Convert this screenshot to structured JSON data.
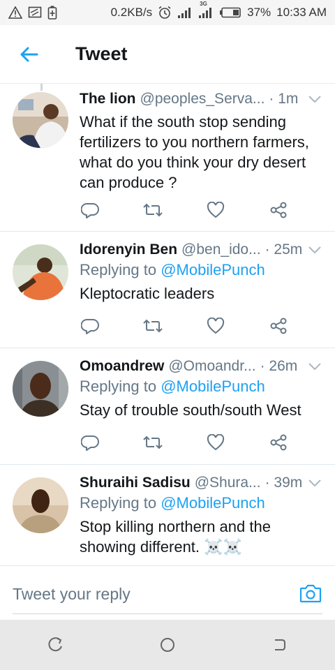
{
  "statusbar": {
    "network_speed": "0.2KB/s",
    "network_type": "3G",
    "battery": "37%",
    "time": "10:33 AM",
    "icons": [
      "warning-icon",
      "cast-icon",
      "battery-saver-icon",
      "alarm-icon",
      "signal-icon",
      "signal-3g-icon",
      "battery-icon"
    ]
  },
  "header": {
    "title": "Tweet",
    "back_icon": "arrow-left-icon"
  },
  "tweets": [
    {
      "name": "The lion",
      "handle": "@peoples_Serva...",
      "time": "· 1m",
      "reply_prefix": "",
      "mention": "",
      "text": "What if the south stop sending fertilizers to you northern farmers, what do you think your dry desert can produce ?"
    },
    {
      "name": "Idorenyin Ben",
      "handle": "@ben_ido...",
      "time": "· 25m",
      "reply_prefix": "Replying to ",
      "mention": "@MobilePunch",
      "text": "Kleptocratic leaders"
    },
    {
      "name": "Omoandrew",
      "handle": "@Omoandr...",
      "time": "· 26m",
      "reply_prefix": "Replying to ",
      "mention": "@MobilePunch",
      "text": "Stay of trouble south/south West"
    },
    {
      "name": "Shuraihi Sadisu",
      "handle": "@Shura...",
      "time": "· 39m",
      "reply_prefix": "Replying to ",
      "mention": "@MobilePunch",
      "text": "Stop killing northern and the showing different. ☠️☠️"
    }
  ],
  "reply_bar": {
    "placeholder": "Tweet your reply",
    "camera_icon": "camera-icon"
  },
  "colors": {
    "accent": "#1da1f2",
    "secondary_text": "#657786",
    "primary_text": "#14171a",
    "divider": "#e1e8ed"
  }
}
